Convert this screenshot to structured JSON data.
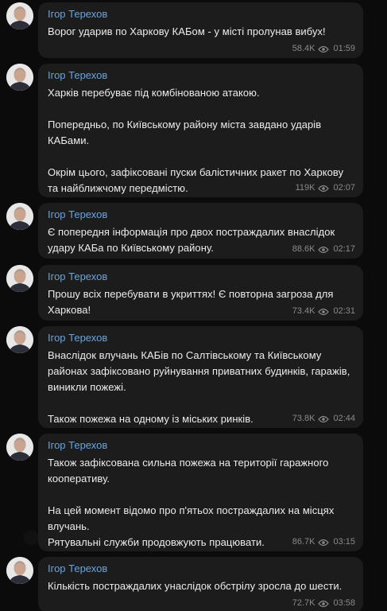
{
  "channel": {
    "author": "Ігор Терехов",
    "accent": "#6aa4dd",
    "bubble_color": "#1c1c1d",
    "background": "#0b0b0b"
  },
  "messages": [
    {
      "author": "Ігор Терехов",
      "paragraphs": [
        "Ворог ударив по Харкову КАБом - у місті пролунав вибух!"
      ],
      "views": "58.4K",
      "time": "01:59"
    },
    {
      "author": "Ігор Терехов",
      "paragraphs": [
        "Харків перебуває під комбінованою атакою.",
        "Попередньо, по Київському району міста завдано ударів КАБами.",
        "Окрім цього, зафіксовані пуски балістичних ракет по Харкову та найближчому передмістю."
      ],
      "views": "119K",
      "time": "02:07"
    },
    {
      "author": "Ігор Терехов",
      "paragraphs": [
        "Є попередня інформація про двох постраждалих внаслідок удару КАБа по Київському району."
      ],
      "views": "88.6K",
      "time": "02:17"
    },
    {
      "author": "Ігор Терехов",
      "paragraphs": [
        "Прошу всіх перебувати в укриттях! Є повторна загроза для Харкова!"
      ],
      "views": "73.4K",
      "time": "02:31"
    },
    {
      "author": "Ігор Терехов",
      "paragraphs": [
        "Внаслідок влучань КАБів по Салтівському та Київському районах зафіксовано руйнування приватних будинків, гаражів, виникли пожежі.",
        "Також пожежа на одному із міських ринків."
      ],
      "views": "73.8K",
      "time": "02:44"
    },
    {
      "author": "Ігор Терехов",
      "paragraphs": [
        "Також зафіксована сильна пожежа на території гаражного кооперативу.",
        "На цей момент відомо про п'ятьох постраждалих на місцях влучань.",
        "Рятувальні служби продовжують працювати."
      ],
      "views": "86.7K",
      "time": "03:15"
    },
    {
      "author": "Ігор Терехов",
      "paragraphs": [
        "Кількість постраждалих унаслідок обстрілу зросла до шести."
      ],
      "views": "72.7K",
      "time": "03:58"
    }
  ]
}
